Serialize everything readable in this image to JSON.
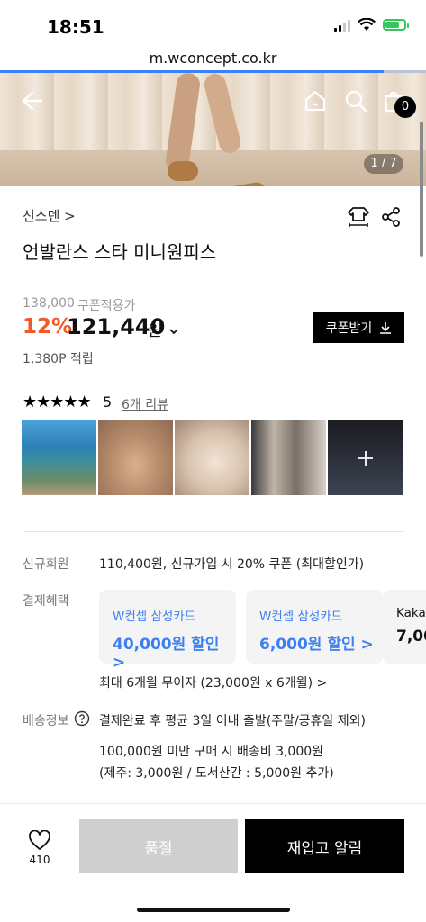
{
  "status_bar": {
    "time": "18:51"
  },
  "browser": {
    "url": "m.wconcept.co.kr",
    "load_progress": 0.9
  },
  "hero": {
    "page_indicator": "1 / 7",
    "cart_count": "0"
  },
  "product": {
    "brand": "신스덴 >",
    "title": "언발란스 스타 미니원피스",
    "original_price": "138,000",
    "coupon_price_label": "쿠폰적용가",
    "discount_rate": "12%",
    "price": "121,440",
    "price_unit": "원",
    "coupon_button": "쿠폰받기",
    "points": "1,380P 적립"
  },
  "reviews": {
    "stars": "★★★★★",
    "rating": "5",
    "review_count": "6개 리뷰",
    "photo_count": 6
  },
  "benefits": {
    "new_member_label": "신규회원",
    "new_member_text": "110,400원, 신규가입 시 20% 쿠폰 (최대할인가)",
    "payment_label": "결제혜택",
    "cards": [
      {
        "name": "W컨셉 삼성카드",
        "amount": "40,000원 할인 >"
      },
      {
        "name": "W컨셉 삼성카드",
        "amount": "6,000원 할인 >"
      },
      {
        "name": "Kakao",
        "amount": "7,00"
      }
    ],
    "installment": "최대 6개월 무이자 (23,000원 x 6개월) >",
    "shipping_label": "배송정보",
    "shipping_text": "결제완료 후 평균 3일 이내 출발(주말/공휴일 제외)",
    "shipping_fee": "100,000원 미만 구매 시 배송비 3,000원",
    "shipping_extra": "(제주: 3,000원 / 도서산간 : 5,000원 추가)"
  },
  "bottom_bar": {
    "like_count": "410",
    "soldout_label": "품절",
    "restock_label": "재입고 알림"
  }
}
